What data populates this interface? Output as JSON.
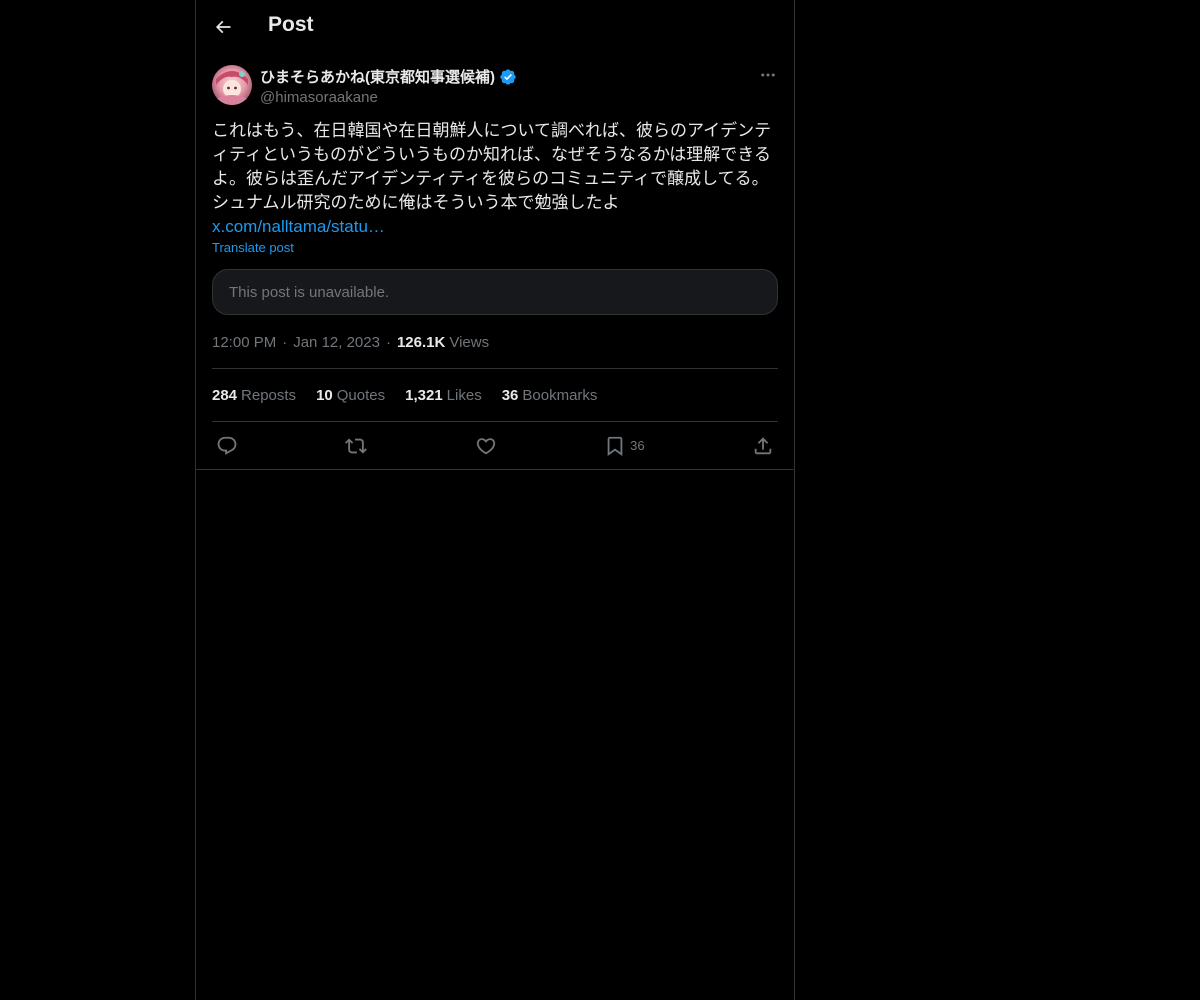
{
  "header": {
    "title": "Post"
  },
  "author": {
    "display_name": "ひまそらあかね(東京都知事選候補)",
    "handle": "@himasoraakane",
    "verified": true
  },
  "post": {
    "text": "これはもう、在日韓国や在日朝鮮人について調べれば、彼らのアイデンティティというものがどういうものか知れば、なぜそうなるかは理解できるよ。彼らは歪んだアイデンティティを彼らのコミュニティで醸成してる。\nシュナムル研究のために俺はそういう本で勉強したよ",
    "link": "x.com/nalltama/statu…",
    "translate_label": "Translate post",
    "quoted_unavailable": "This post is unavailable."
  },
  "meta": {
    "time": "12:00 PM",
    "date": "Jan 12, 2023",
    "views_count": "126.1K",
    "views_label": "Views",
    "separator": "·"
  },
  "stats": {
    "reposts_count": "284",
    "reposts_label": "Reposts",
    "quotes_count": "10",
    "quotes_label": "Quotes",
    "likes_count": "1,321",
    "likes_label": "Likes",
    "bookmarks_count": "36",
    "bookmarks_label": "Bookmarks"
  },
  "actions": {
    "bookmark_count": "36"
  },
  "colors": {
    "background": "#000000",
    "text": "#e7e9ea",
    "muted": "#71767b",
    "accent": "#1d9bf0",
    "border": "#2f3336"
  }
}
